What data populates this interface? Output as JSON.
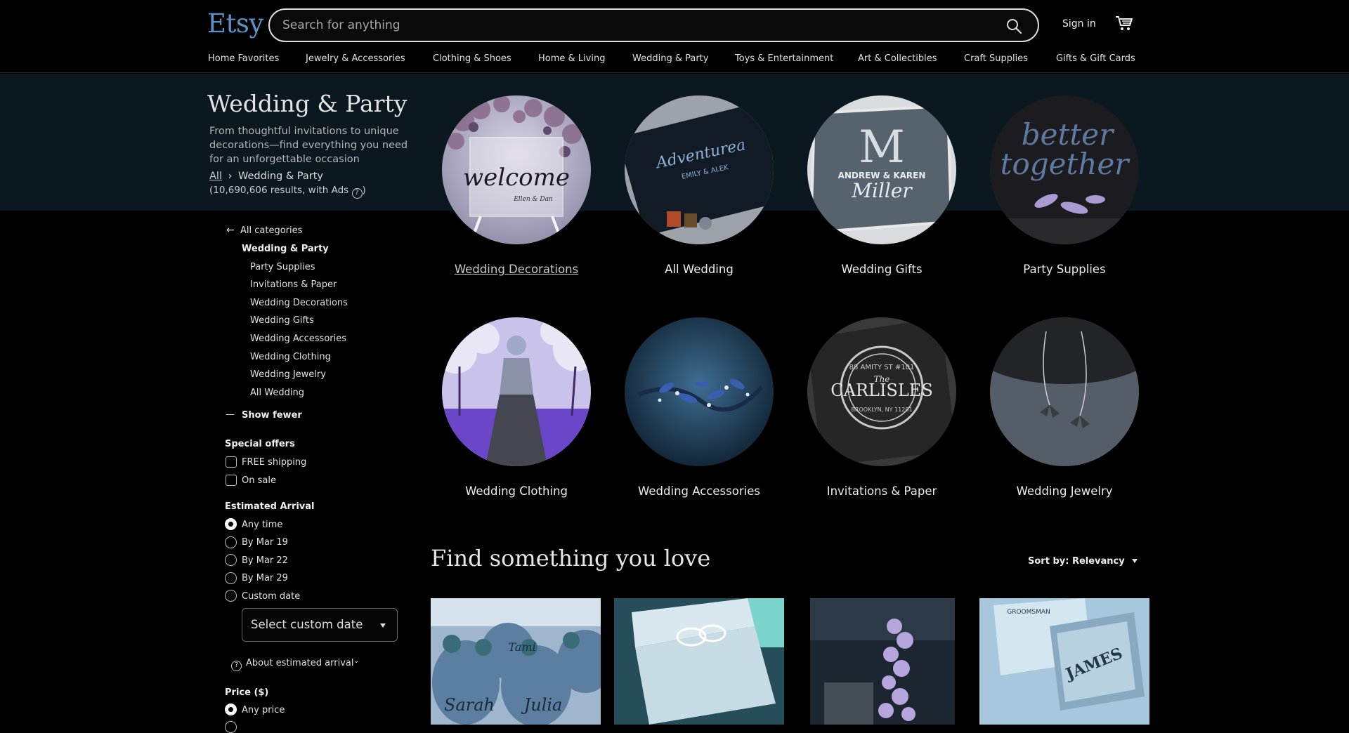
{
  "header": {
    "logo": "Etsy",
    "search_placeholder": "Search for anything",
    "signin": "Sign in",
    "nav": [
      "Home Favorites",
      "Jewelry & Accessories",
      "Clothing & Shoes",
      "Home & Living",
      "Wedding & Party",
      "Toys & Entertainment",
      "Art & Collectibles",
      "Craft Supplies",
      "Gifts & Gift Cards"
    ]
  },
  "hero": {
    "title": "Wedding & Party",
    "description": "From thoughtful invitations to unique decorations—find everything you need for an unforgettable occasion",
    "breadcrumb_root": "All",
    "breadcrumb_sep": "›",
    "breadcrumb_current": "Wedding & Party",
    "results_text": "(10,690,606 results, with Ads",
    "results_close": ")"
  },
  "categories": [
    {
      "label": "Wedding Decorations"
    },
    {
      "label": "All Wedding"
    },
    {
      "label": "Wedding Gifts"
    },
    {
      "label": "Party Supplies"
    },
    {
      "label": "Wedding Clothing"
    },
    {
      "label": "Wedding Accessories"
    },
    {
      "label": "Invitations & Paper"
    },
    {
      "label": "Wedding Jewelry"
    }
  ],
  "category_images": {
    "welcome": "welcome",
    "welcome_sub": "Ellen & Dan",
    "adventure": "Adventurea",
    "adventure_names": "EMILY & ALEK",
    "monogram": "M",
    "monogram_names": "ANDREW & KAREN",
    "monogram_last": "Miller",
    "better": "better",
    "together": "together",
    "carlisles_the": "The",
    "carlisles": "CARLISLES",
    "carlisles_top": "88 AMITY ST #101",
    "carlisles_bottom": "BROOKLYN, NY 11201"
  },
  "sidebar": {
    "all_categories": "All categories",
    "current": "Wedding & Party",
    "subcats": [
      "Party Supplies",
      "Invitations & Paper",
      "Wedding Decorations",
      "Wedding Gifts",
      "Wedding Accessories",
      "Wedding Clothing",
      "Wedding Jewelry",
      "All Wedding"
    ],
    "show_fewer": "Show fewer",
    "special_offers": "Special offers",
    "offers": [
      "FREE shipping",
      "On sale"
    ],
    "estimated_arrival": "Estimated Arrival",
    "arrival_options": [
      "Any time",
      "By Mar 19",
      "By Mar 22",
      "By Mar 29",
      "Custom date"
    ],
    "arrival_selected": "Any time",
    "select_custom_date": "Select custom date",
    "about_arrival": "About estimated arrival",
    "price": "Price ($)",
    "price_options": [
      "Any price"
    ]
  },
  "listing": {
    "title": "Find something you love",
    "sort": "Sort by: Relevancy",
    "product_texts": [
      "Sarah",
      "Julia",
      "Tami",
      "JAMES",
      "GROOMSMAN"
    ]
  },
  "colors": {
    "brand": "#5a93c9",
    "hero_bg": "#0b1820"
  }
}
